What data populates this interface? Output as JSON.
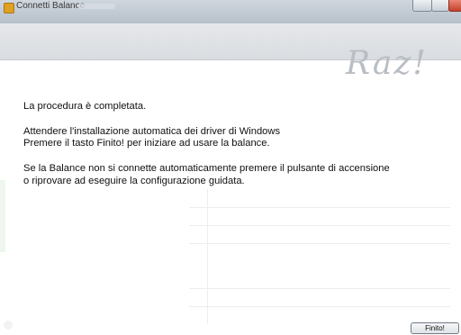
{
  "window": {
    "title": "Connetti Balance"
  },
  "banner": {
    "logo_text": "Raz!"
  },
  "message": {
    "line1": "La procedura è completata.",
    "line2": "Attendere l'installazione automatica dei driver di Windows",
    "line3": "Premere il tasto Finito! per iniziare ad usare la balance.",
    "line4": "Se la Balance non si connette automaticamente premere il pulsante di accensione",
    "line5": "o riprovare ad eseguire la configurazione guidata."
  },
  "buttons": {
    "finish_label": "Finito!"
  },
  "colors": {
    "title_bar": "#c4ccd5",
    "banner": "#e0e3e6",
    "close_button": "#d4503c"
  },
  "icons": [
    "app-icon",
    "minimize-icon",
    "maximize-icon",
    "close-icon"
  ]
}
